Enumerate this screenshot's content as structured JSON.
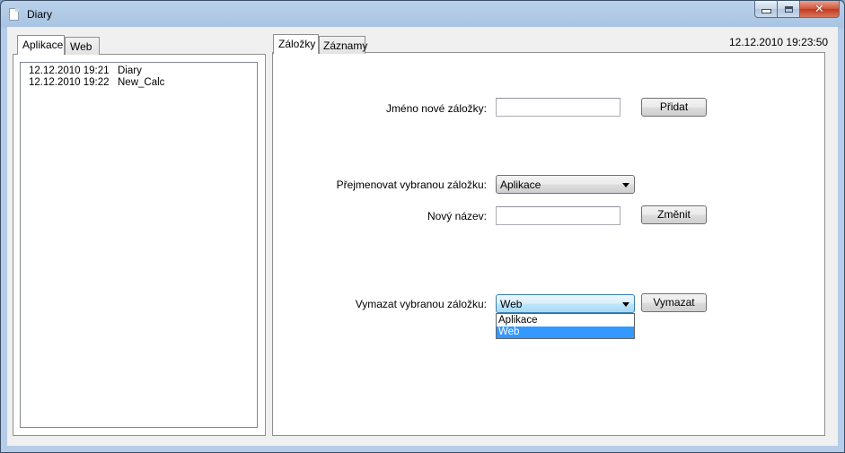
{
  "window": {
    "title": "Diary"
  },
  "left_tabs": [
    {
      "label": "Aplikace",
      "active": true
    },
    {
      "label": "Web",
      "active": false
    }
  ],
  "entries": [
    {
      "time": "12.12.2010 19:21",
      "name": "Diary"
    },
    {
      "time": "12.12.2010 19:22",
      "name": "New_Calc"
    }
  ],
  "right_tabs": [
    {
      "label": "Záložky",
      "active": true
    },
    {
      "label": "Záznamy",
      "active": false
    }
  ],
  "clock": "12.12.2010 19:23:50",
  "form": {
    "new_label": "Jméno nové záložky:",
    "new_value": "",
    "add_button": "Přidat",
    "rename_label": "Přejmenovat vybranou záložku:",
    "rename_selected": "Aplikace",
    "new_name_label": "Nový název:",
    "new_name_value": "",
    "change_button": "Změnit",
    "delete_label": "Vymazat vybranou záložku:",
    "delete_selected": "Web",
    "delete_button": "Vymazat",
    "delete_options": [
      "Aplikace",
      "Web"
    ]
  },
  "icons": {
    "app": "document-icon",
    "minimize": "minimize-icon",
    "maximize": "maximize-icon",
    "close": "close-icon"
  },
  "colors": {
    "selection": "#3399ff",
    "close_button": "#c9462c"
  }
}
